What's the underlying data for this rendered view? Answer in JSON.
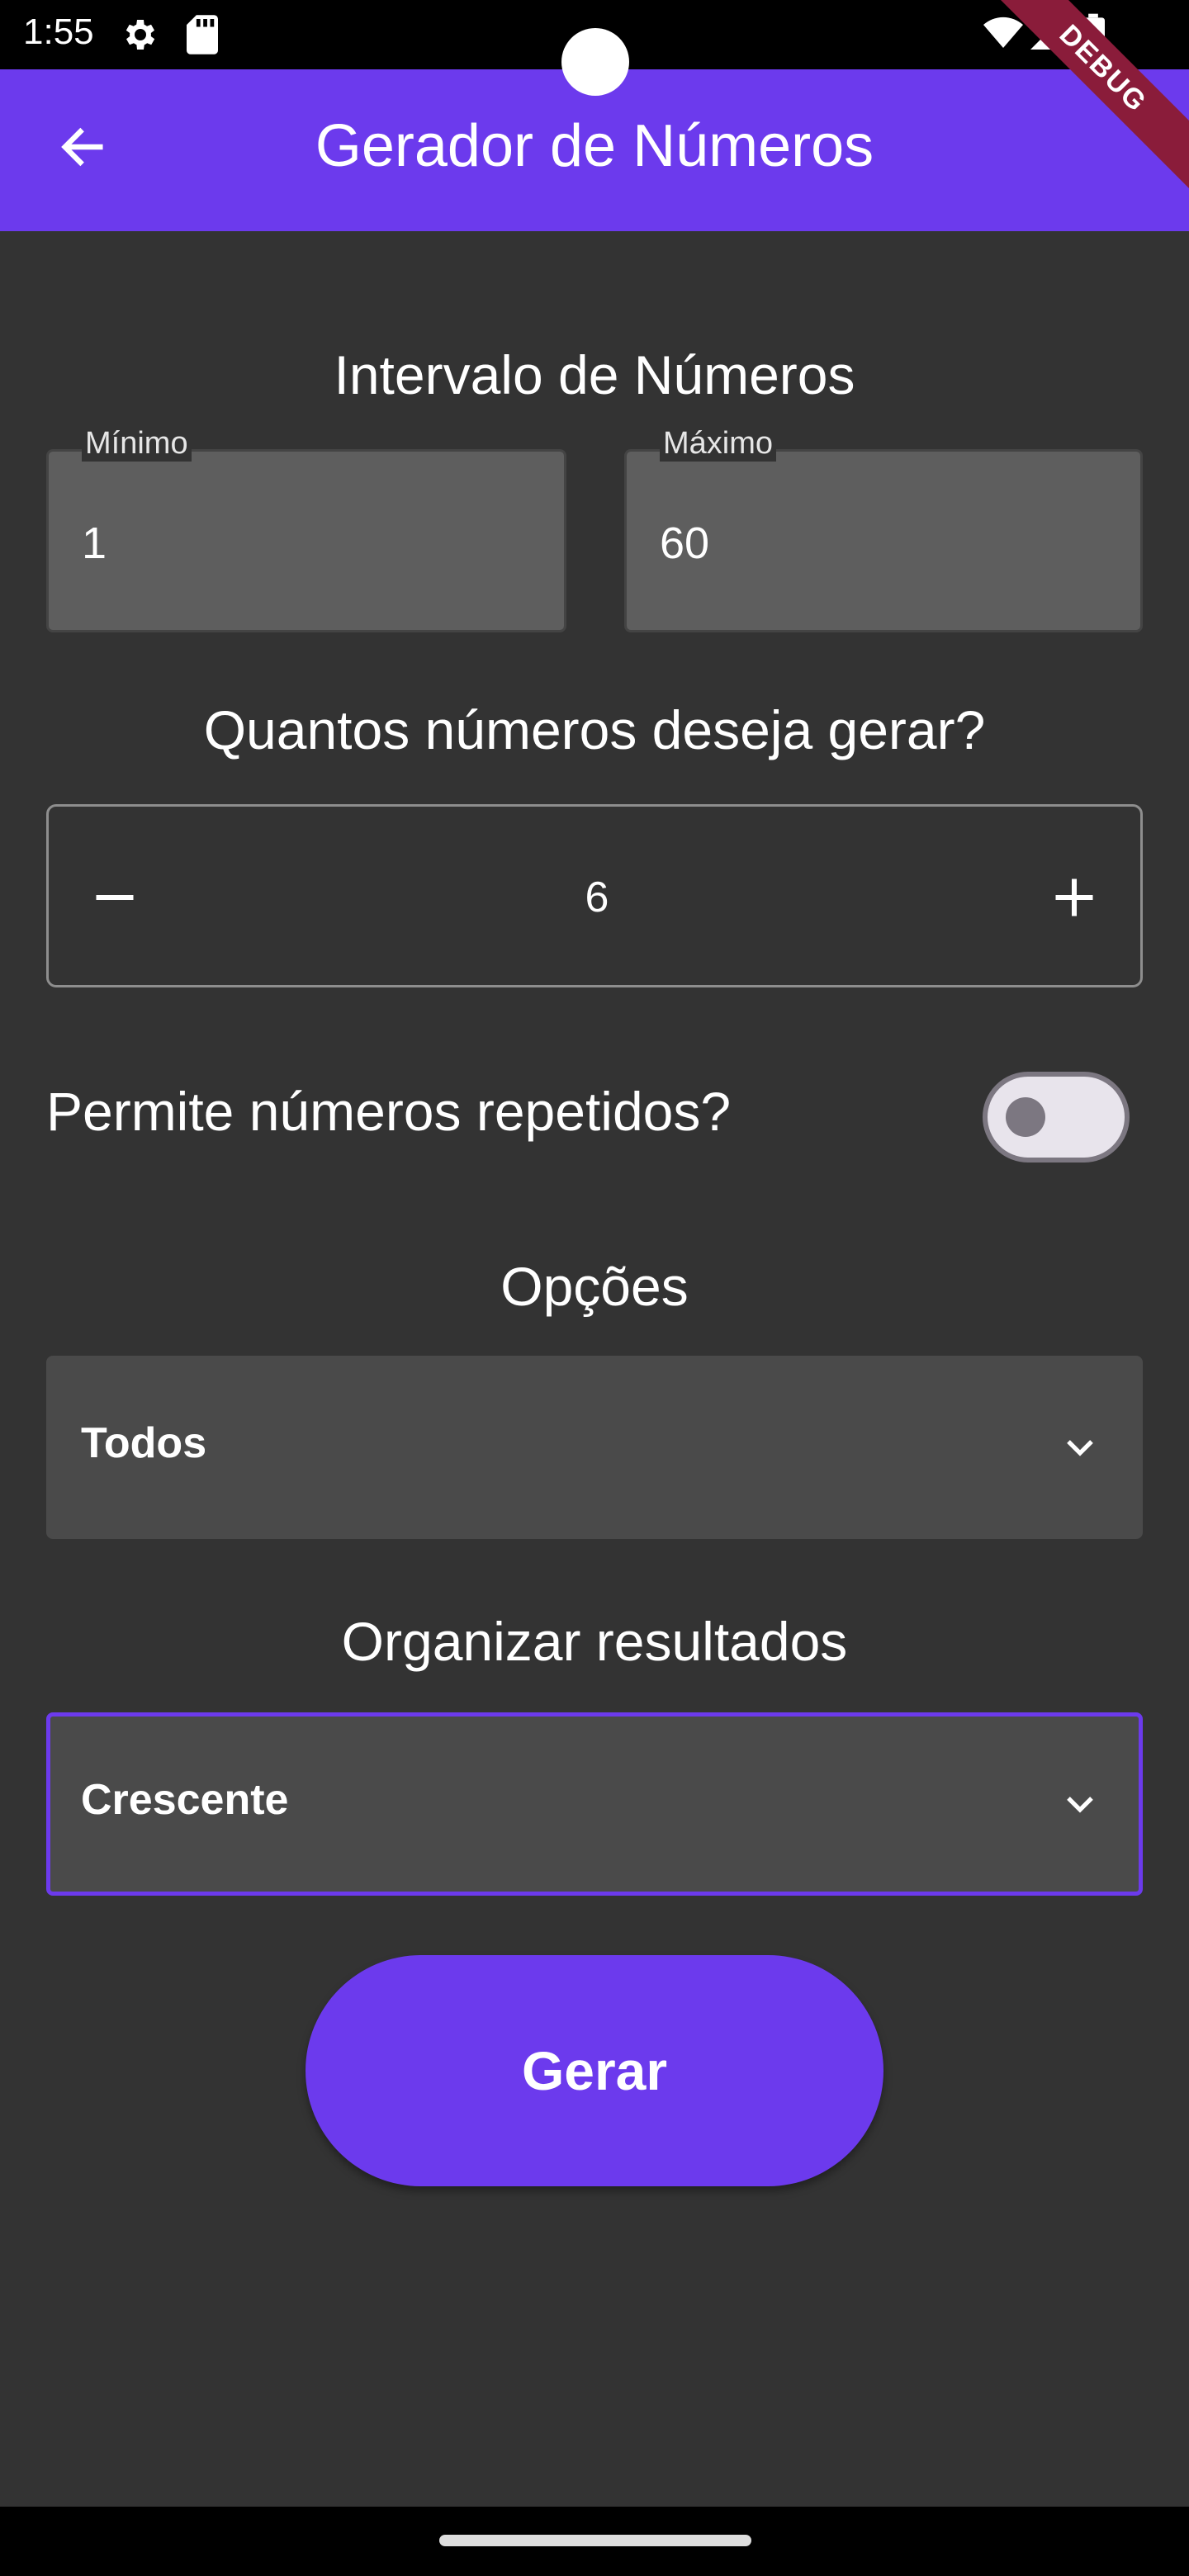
{
  "status_bar": {
    "time": "1:55",
    "icons": [
      "gear-icon",
      "sd-card-icon",
      "wifi-icon",
      "signal-icon",
      "battery-icon"
    ]
  },
  "app_bar": {
    "title": "Gerador de Números",
    "back_icon": "arrow-back-icon",
    "debug_banner": "DEBUG",
    "color": "#6c3aed"
  },
  "interval": {
    "title": "Intervalo de Números",
    "min": {
      "label": "Mínimo",
      "value": "1"
    },
    "max": {
      "label": "Máximo",
      "value": "60"
    }
  },
  "quantity": {
    "title": "Quantos números deseja gerar?",
    "value": "6",
    "decrement_icon": "minus-icon",
    "increment_icon": "plus-icon"
  },
  "repeat": {
    "label": "Permite números repetidos?",
    "enabled": false
  },
  "options": {
    "title": "Opções",
    "selected": "Todos"
  },
  "sort": {
    "title": "Organizar resultados",
    "selected": "Crescente"
  },
  "actions": {
    "generate_label": "Gerar"
  },
  "colors": {
    "accent": "#6c3aed",
    "background": "#333333",
    "field": "#5e5e5e",
    "select": "#4a4a4a"
  }
}
